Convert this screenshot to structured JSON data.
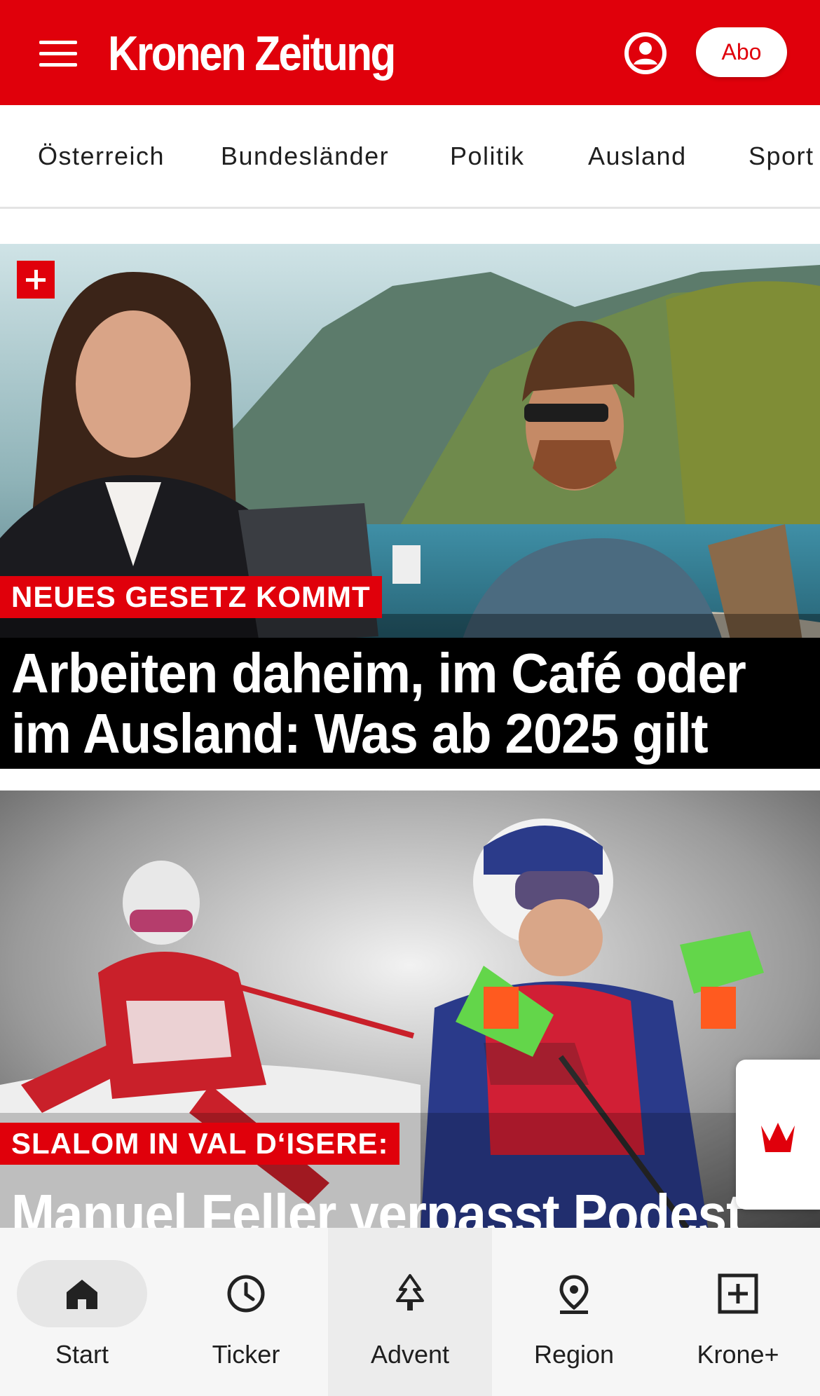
{
  "header": {
    "logo": "Kronen Zeitung",
    "abo_label": "Abo",
    "brand_color": "#e0000b"
  },
  "nav": {
    "items": [
      "Österreich",
      "Bundesländer",
      "Politik",
      "Ausland",
      "Sport"
    ]
  },
  "articles": [
    {
      "kicker": "NEUES GESETZ KOMMT",
      "headline_line1": "Arbeiten daheim, im Café oder",
      "headline_line2": "im Ausland: Was ab 2025 gilt",
      "badge": "plus-icon"
    },
    {
      "kicker": "SLALOM IN VAL D‘ISERE:",
      "headline_line1": "Manuel Feller verpasst Podest"
    }
  ],
  "floating_tab": {
    "icon": "krone-crown-icon"
  },
  "bottom_nav": {
    "tabs": [
      {
        "label": "Start",
        "icon": "home-icon"
      },
      {
        "label": "Ticker",
        "icon": "clock-icon"
      },
      {
        "label": "Advent",
        "icon": "tree-icon"
      },
      {
        "label": "Region",
        "icon": "location-pin-icon"
      },
      {
        "label": "Krone+",
        "icon": "plus-box-icon"
      }
    ]
  }
}
